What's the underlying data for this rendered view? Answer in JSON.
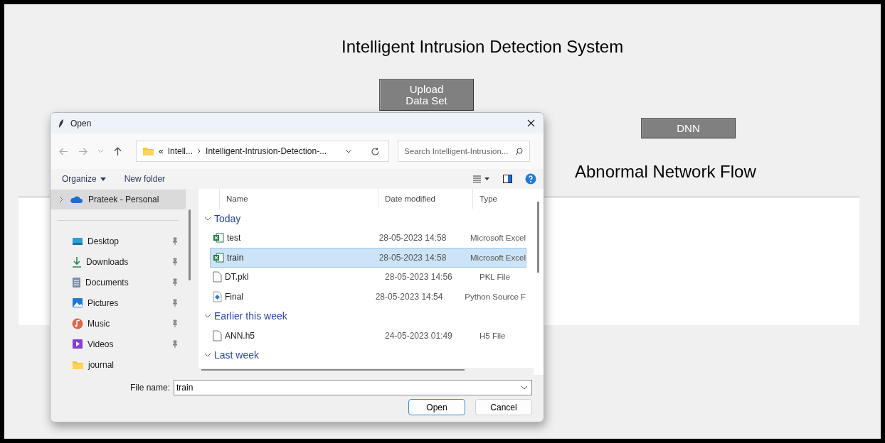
{
  "app": {
    "title": "Intelligent Intrusion Detection System",
    "upload_button": "Upload Data Set",
    "dnn_button": "DNN",
    "section_title": "Abnormal Network Flow"
  },
  "dialog": {
    "title": "Open",
    "path": {
      "overflow": "«",
      "segments": [
        "Intell...",
        "Intelligent-Intrusion-Detection-..."
      ]
    },
    "search": {
      "placeholder": "Search Intelligent-Intrusion..."
    },
    "toolbar": {
      "organize": "Organize",
      "new_folder": "New folder"
    },
    "sidebar": {
      "items": [
        {
          "label": "Prateek - Personal",
          "kind": "cloud",
          "selected": true,
          "pinned": false
        },
        {
          "label": "Desktop",
          "kind": "desktop",
          "selected": false,
          "pinned": true
        },
        {
          "label": "Downloads",
          "kind": "download",
          "selected": false,
          "pinned": true
        },
        {
          "label": "Documents",
          "kind": "document",
          "selected": false,
          "pinned": true
        },
        {
          "label": "Pictures",
          "kind": "pictures",
          "selected": false,
          "pinned": true
        },
        {
          "label": "Music",
          "kind": "music",
          "selected": false,
          "pinned": true
        },
        {
          "label": "Videos",
          "kind": "videos",
          "selected": false,
          "pinned": true
        },
        {
          "label": "journal",
          "kind": "folder",
          "selected": false,
          "pinned": false
        }
      ]
    },
    "columns": [
      "Name",
      "Date modified",
      "Type"
    ],
    "groups": [
      {
        "label": "Today",
        "expanded": true,
        "files": [
          {
            "name": "test",
            "date": "28-05-2023 14:58",
            "type": "Microsoft Excel",
            "kind": "excel",
            "selected": false
          },
          {
            "name": "train",
            "date": "28-05-2023 14:58",
            "type": "Microsoft Excel",
            "kind": "excel",
            "selected": true
          },
          {
            "name": "DT.pkl",
            "date": "28-05-2023 14:56",
            "type": "PKL File",
            "kind": "file",
            "selected": false
          },
          {
            "name": "Final",
            "date": "28-05-2023 14:54",
            "type": "Python Source F",
            "kind": "python",
            "selected": false
          }
        ]
      },
      {
        "label": "Earlier this week",
        "expanded": true,
        "files": [
          {
            "name": "ANN.h5",
            "date": "24-05-2023 01:49",
            "type": "H5 File",
            "kind": "file",
            "selected": false
          }
        ]
      },
      {
        "label": "Last week",
        "expanded": true
      }
    ],
    "file_name": {
      "label": "File name:",
      "value": "train"
    },
    "buttons": {
      "open": "Open",
      "cancel": "Cancel"
    }
  }
}
